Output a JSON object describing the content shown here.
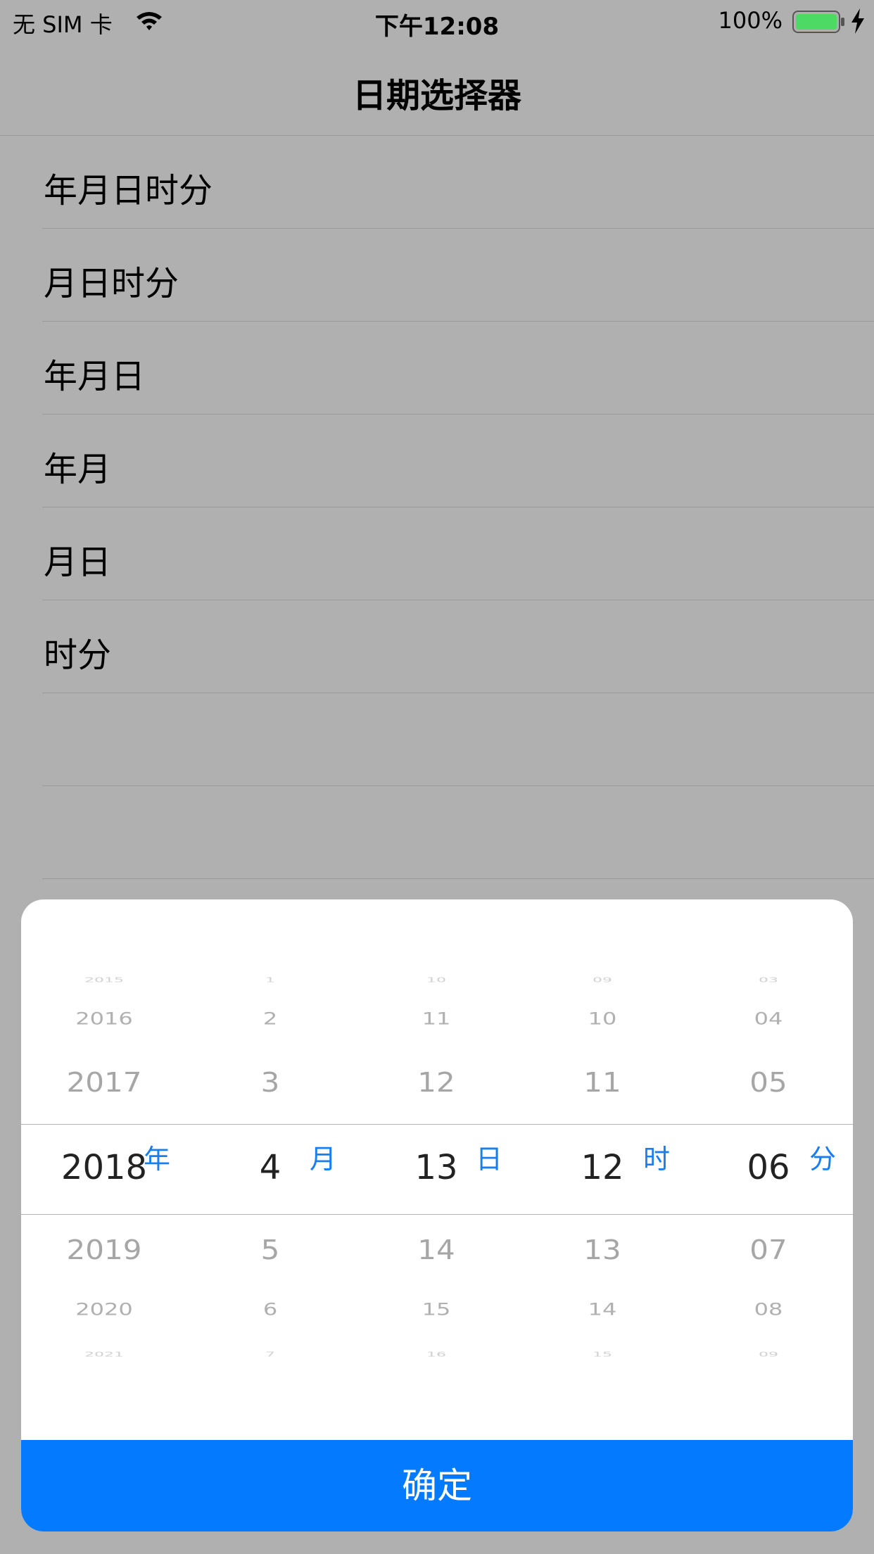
{
  "status_bar": {
    "carrier": "无 SIM 卡",
    "time": "下午12:08",
    "battery": "100%",
    "wifi_icon": "wifi-icon",
    "battery_icon": "battery-icon",
    "charging_icon": "bolt-icon"
  },
  "nav": {
    "title": "日期选择器"
  },
  "list": {
    "items": [
      {
        "label": "年月日时分"
      },
      {
        "label": "月日时分"
      },
      {
        "label": "年月日"
      },
      {
        "label": "年月"
      },
      {
        "label": "月日"
      },
      {
        "label": "时分"
      },
      {
        "label": ""
      },
      {
        "label": ""
      }
    ]
  },
  "picker": {
    "columns": [
      {
        "unit": "年",
        "values": [
          "2015",
          "2016",
          "2017",
          "2018",
          "2019",
          "2020",
          "2021"
        ],
        "selected": "2018"
      },
      {
        "unit": "月",
        "values": [
          "1",
          "2",
          "3",
          "4",
          "5",
          "6",
          "7"
        ],
        "selected": "4"
      },
      {
        "unit": "日",
        "values": [
          "10",
          "11",
          "12",
          "13",
          "14",
          "15",
          "16"
        ],
        "selected": "13"
      },
      {
        "unit": "时",
        "values": [
          "09",
          "10",
          "11",
          "12",
          "13",
          "14",
          "15"
        ],
        "selected": "12"
      },
      {
        "unit": "分",
        "values": [
          "03",
          "04",
          "05",
          "06",
          "07",
          "08",
          "09"
        ],
        "selected": "06"
      }
    ],
    "confirm_label": "确定",
    "accent_color": "#047bff"
  }
}
